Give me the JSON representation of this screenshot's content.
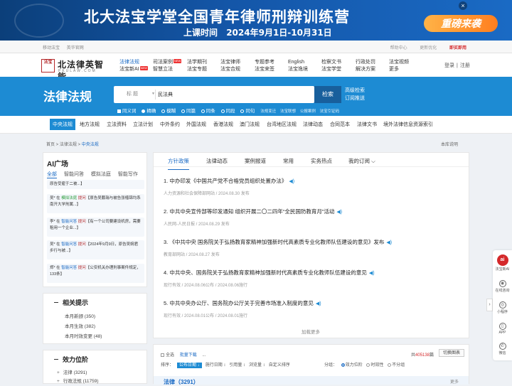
{
  "banner": {
    "title": "北大法宝学堂全国青年律师刑辩训练营",
    "time_label": "上课时间",
    "time_value": "2024年9月1日-10月31日",
    "cta": "重磅来袭",
    "close": "×"
  },
  "topbar": {
    "left": [
      "移动法宝",
      "英华官网"
    ],
    "right": [
      "帮助中心",
      "更新优化",
      "即买即用"
    ]
  },
  "logo": {
    "seal": "法宝",
    "name": "北法律英智能",
    "en": "PKULAW.COM"
  },
  "nav": [
    {
      "top": "法律法规",
      "bottom": "法宝新AI",
      "top_active": true,
      "badge": "NEW"
    },
    {
      "top": "司法案例",
      "bottom": "智慧立法",
      "badge": "NEW"
    },
    {
      "top": "法学期刊",
      "bottom": "法宝专题"
    },
    {
      "top": "法宝律师",
      "bottom": "法宝合规"
    },
    {
      "top": "专题参考",
      "bottom": "法宝来签"
    },
    {
      "top": "English",
      "bottom": "法宝逸境"
    },
    {
      "top": "检察文书",
      "bottom": "法宝学堂"
    },
    {
      "top": "行政处罚",
      "bottom": "解决方案"
    },
    {
      "top": "法宝视频",
      "bottom": "更多"
    }
  ],
  "login": {
    "login": "登录",
    "register": "注册"
  },
  "hero": {
    "title": "法律法规",
    "search_scope": "标 题",
    "search_value": "民法典",
    "search_button": "检索",
    "advanced": "高级检索",
    "subscribe": "订阅推送",
    "options": [
      "同义词",
      "精确",
      "模糊",
      "同篇",
      "同条",
      "同段",
      "同句"
    ],
    "links": [
      "法规变迁",
      "法宝联想",
      "公报案例",
      "法宝引证码"
    ]
  },
  "categories": [
    "中央法规",
    "地方法规",
    "立法资料",
    "立法计划",
    "中外条约",
    "外国法规",
    "香港法规",
    "澳门法规",
    "台湾地区法规",
    "法律动态",
    "合同范本",
    "法律文书",
    "境外法律信息资源索引"
  ],
  "breadcrumb": {
    "home": "首页",
    "sep1": " > ",
    "mid": "法律法规",
    "sep2": " > ",
    "current": "中央法规"
  },
  "help_link": "本库说明",
  "ai": {
    "title": "AI广场",
    "tabs": [
      "全部",
      "智能问答",
      "模拟法庭",
      "智能写作"
    ],
    "items": [
      {
        "user": "",
        "tag": "",
        "tag_type": "",
        "text": "原告受雇于二被...】"
      },
      {
        "user": "吴*",
        "tag": "模拟法庭",
        "tag_type": "g",
        "text": "【原告吴鹏瑞与被告张楷锦均系南开大学刑属...】"
      },
      {
        "user": "李*",
        "tag": "智能问答",
        "tag_type": "q",
        "text": "【有一个公司要建设机房，需要租用一个企业...】"
      },
      {
        "user": "吴*",
        "tag": "智能问答",
        "tag_type": "q",
        "text": "【2024年9月9日，原告吴婉君步行与被...】"
      },
      {
        "user": "郑*",
        "tag": "智能问答",
        "tag_type": "q",
        "text": "【公安机关办理刑事案件规定，133条】"
      }
    ],
    "connector": "在",
    "action": "提问"
  },
  "hints": {
    "title": "相关提示",
    "rows": [
      "本月新颁 (350)",
      "本月生效 (382)",
      "本月时效变更 (48)"
    ]
  },
  "effect": {
    "title": "效力位阶",
    "rows": [
      "法律 (3291)",
      "行政法规 (11759)"
    ]
  },
  "news": {
    "tabs": [
      "方针政策",
      "法律动态",
      "案例报道",
      "常用",
      "实务热点",
      "我的订阅"
    ],
    "items": [
      {
        "title": "1. 中办印发《中国共产党不合格党员组织处置办法》",
        "meta": "人力资源和社会保障部网站 / 2024.08.30 发布"
      },
      {
        "title": "2. 中共中央宣传部等印发通知 组织开展二〇二四年“全民国防教育月”活动",
        "meta": "人民网-人民日报 / 2024.08.29 发布"
      },
      {
        "title": "3. 《中共中央 国务院关于弘扬教育家精神加强新时代高素质专业化教师队伍建设的意见》发布",
        "meta": "教育部网站 / 2024.08.27 发布"
      },
      {
        "title": "4. 中共中央、国务院关于弘扬教育家精神加强新时代高素质专业化教师队伍建设的意见",
        "meta": "现行有效 / 2024.08.06公布 / 2024.08.06施行"
      },
      {
        "title": "5. 中共中央办公厅、国务院办公厅关于完善市场准入制度的意见",
        "meta": "现行有效 / 2024.08.01公布 / 2024.08.01施行"
      }
    ],
    "more": "加载更多"
  },
  "results": {
    "select_all": "全选",
    "batch_download": "批量下载",
    "ellipsis": "...",
    "total_prefix": "共",
    "total": "405138",
    "total_suffix": "篇",
    "switch": "切换图表",
    "sort_label": "排序：",
    "sorts": [
      "公布日期 ↓",
      "施行日期 ↕",
      "引用量 ↕",
      "浏览量 ↕",
      "自定义排序"
    ],
    "group_label": "分组：",
    "groups": [
      "效力位阶",
      "时效性",
      "不分组"
    ],
    "law_title": "法律（3291）",
    "law_more": "更多"
  },
  "sidebar": [
    {
      "label": "法宝新AI",
      "icon": "ai"
    },
    {
      "label": "在线咨询",
      "icon": "◉"
    },
    {
      "label": "小程序",
      "icon": "◎"
    },
    {
      "label": "APP",
      "icon": "▯"
    },
    {
      "label": "微信",
      "icon": "✆"
    }
  ],
  "sidebar_arrow": "›"
}
